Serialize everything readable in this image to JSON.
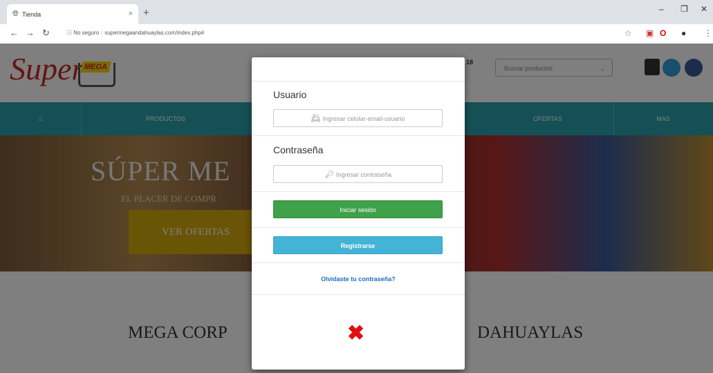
{
  "browser": {
    "tab_title": "Tienda",
    "tab_icon": "globe-icon",
    "url_security": "No seguro",
    "url": "supermegaandahuaylas.com/index.php#"
  },
  "page": {
    "logo_text": "Super",
    "logo_badge": "MEGA",
    "search_placeholder": "Buscar productos",
    "nav": [
      "PRODUCTOS",
      "OFERTAS",
      "MAS"
    ],
    "banner_title": "SÚPER ME",
    "banner_subtitle": "EL PLACER DE COMPR",
    "banner_button": "VER OFERTAS",
    "corp_left": "MEGA CORP",
    "corp_right": "DAHUAYLAS"
  },
  "modal": {
    "user_label": "Usuario",
    "user_placeholder": "Ingresar celular-email-usuario",
    "password_label": "Contraseña",
    "password_placeholder": "Ingresar contraseña",
    "login_button": "Iniciar sesión",
    "register_button": "Registrarse",
    "forgot_link": "Olvidaste tu contraseña?",
    "close_glyph": "✖"
  },
  "colors": {
    "nav_bg": "#2aa0ac",
    "login_green": "#3fa14a",
    "register_blue": "#43b3d6",
    "link_blue": "#1e6fc4",
    "close_red": "#e01010"
  }
}
